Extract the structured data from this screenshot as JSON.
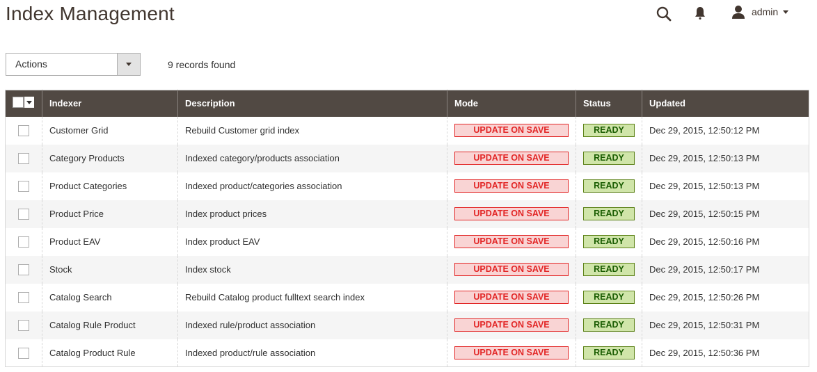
{
  "page": {
    "title": "Index Management"
  },
  "header": {
    "search_icon": "search-icon",
    "notifications_icon": "bell-icon",
    "user": {
      "icon": "user-icon",
      "name": "admin"
    }
  },
  "toolbar": {
    "actions_label": "Actions",
    "records_found": "9 records found"
  },
  "grid": {
    "columns": [
      "Indexer",
      "Description",
      "Mode",
      "Status",
      "Updated"
    ],
    "rows": [
      {
        "indexer": "Customer Grid",
        "description": "Rebuild Customer grid index",
        "mode": "UPDATE ON SAVE",
        "status": "READY",
        "updated": "Dec 29, 2015, 12:50:12 PM"
      },
      {
        "indexer": "Category Products",
        "description": "Indexed category/products association",
        "mode": "UPDATE ON SAVE",
        "status": "READY",
        "updated": "Dec 29, 2015, 12:50:13 PM"
      },
      {
        "indexer": "Product Categories",
        "description": "Indexed product/categories association",
        "mode": "UPDATE ON SAVE",
        "status": "READY",
        "updated": "Dec 29, 2015, 12:50:13 PM"
      },
      {
        "indexer": "Product Price",
        "description": "Index product prices",
        "mode": "UPDATE ON SAVE",
        "status": "READY",
        "updated": "Dec 29, 2015, 12:50:15 PM"
      },
      {
        "indexer": "Product EAV",
        "description": "Index product EAV",
        "mode": "UPDATE ON SAVE",
        "status": "READY",
        "updated": "Dec 29, 2015, 12:50:16 PM"
      },
      {
        "indexer": "Stock",
        "description": "Index stock",
        "mode": "UPDATE ON SAVE",
        "status": "READY",
        "updated": "Dec 29, 2015, 12:50:17 PM"
      },
      {
        "indexer": "Catalog Search",
        "description": "Rebuild Catalog product fulltext search index",
        "mode": "UPDATE ON SAVE",
        "status": "READY",
        "updated": "Dec 29, 2015, 12:50:26 PM"
      },
      {
        "indexer": "Catalog Rule Product",
        "description": "Indexed rule/product association",
        "mode": "UPDATE ON SAVE",
        "status": "READY",
        "updated": "Dec 29, 2015, 12:50:31 PM"
      },
      {
        "indexer": "Catalog Product Rule",
        "description": "Indexed product/rule association",
        "mode": "UPDATE ON SAVE",
        "status": "READY",
        "updated": "Dec 29, 2015, 12:50:36 PM"
      }
    ]
  },
  "colors": {
    "header_bg": "#514943",
    "mode_text": "#e22626",
    "mode_bg": "#f9d4d4",
    "status_text": "#185b00",
    "status_bg": "#d0e5a9"
  }
}
